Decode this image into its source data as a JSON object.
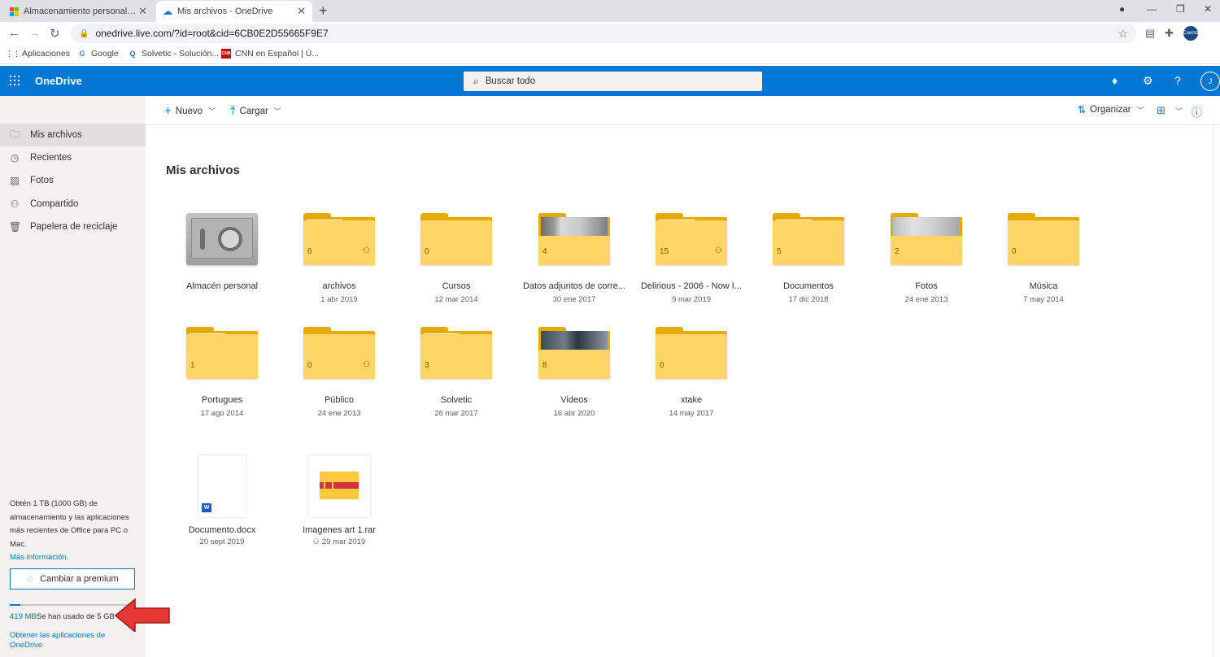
{
  "browser": {
    "tabs": [
      {
        "title": "Almacenamiento personal en la n",
        "active": false
      },
      {
        "title": "Mis archivos - OneDrive",
        "active": true
      }
    ],
    "url": "onedrive.live.com/?id=root&cid=6CB0E2D55665F9E7",
    "profile_label": "Cuenta",
    "bookmarks": [
      {
        "label": "Aplicaciones",
        "icon": "apps-grid-icon"
      },
      {
        "label": "Google",
        "icon": "google-icon"
      },
      {
        "label": "Solvetic - Solución...",
        "icon": "solvetic-icon"
      },
      {
        "label": "CNN en Español | Ú...",
        "icon": "cnn-icon"
      }
    ]
  },
  "header": {
    "brand": "OneDrive",
    "search_placeholder": "Buscar todo",
    "avatar_initial": "J",
    "brand_color": "#0078d4"
  },
  "nav": {
    "items": [
      {
        "label": "Mis archivos",
        "icon": "folder-icon",
        "selected": true
      },
      {
        "label": "Recientes",
        "icon": "clock-icon",
        "selected": false
      },
      {
        "label": "Fotos",
        "icon": "image-icon",
        "selected": false
      },
      {
        "label": "Compartido",
        "icon": "people-icon",
        "selected": false
      },
      {
        "label": "Papelera de reciclaje",
        "icon": "trash-icon",
        "selected": false
      }
    ],
    "promo_text": "Obtén 1 TB (1000 GB) de almacenamiento y las aplicaciones más recientes de Office para PC o Mac.",
    "promo_link": "Más información.",
    "premium_button": "Cambiar a premium",
    "usage_value": "419 MB",
    "usage_text": "Se han usado de 5 GB",
    "usage_fraction": 0.082,
    "get_apps": "Obtener las aplicaciones de OneDrive"
  },
  "commands": {
    "new_label": "Nuevo",
    "upload_label": "Cargar",
    "sort_label": "Organizar"
  },
  "main": {
    "title": "Mis archivos",
    "items": [
      {
        "name": "Almacén personal",
        "date": "",
        "kind": "vault"
      },
      {
        "name": "archivos",
        "date": "1 abr 2019",
        "kind": "folder",
        "count": "6",
        "shared": true
      },
      {
        "name": "Cursos",
        "date": "12 mar 2014",
        "kind": "folder",
        "count": "0",
        "shared": false
      },
      {
        "name": "Datos adjuntos de corre...",
        "date": "30 ene 2017",
        "kind": "folder-photo",
        "count": "4",
        "shared": false
      },
      {
        "name": "Delirious - 2006 - Now I...",
        "date": "9 mar 2019",
        "kind": "folder",
        "count": "15",
        "shared": true
      },
      {
        "name": "Documentos",
        "date": "17 dic 2018",
        "kind": "folder",
        "count": "5",
        "shared": false
      },
      {
        "name": "Fotos",
        "date": "24 ene 2013",
        "kind": "folder-photo",
        "count": "2",
        "shared": false
      },
      {
        "name": "Música",
        "date": "7 may 2014",
        "kind": "folder",
        "count": "0",
        "shared": false
      },
      {
        "name": "Portugues",
        "date": "17 ago 2014",
        "kind": "folder",
        "count": "1",
        "shared": false
      },
      {
        "name": "Público",
        "date": "24 ene 2013",
        "kind": "folder",
        "count": "0",
        "shared": true
      },
      {
        "name": "Solvetic",
        "date": "26 mar 2017",
        "kind": "folder",
        "count": "3",
        "shared": false
      },
      {
        "name": "Videos",
        "date": "16 abr 2020",
        "kind": "folder-photo",
        "count": "8",
        "shared": false
      },
      {
        "name": "xtake",
        "date": "14 may 2017",
        "kind": "folder",
        "count": "0",
        "shared": false
      },
      {
        "name": "Documento.docx",
        "date": "20 sept 2019",
        "kind": "docx"
      },
      {
        "name": "Imagenes art 1.rar",
        "date": "29 mar 2019",
        "kind": "rar",
        "shared": true
      }
    ]
  }
}
